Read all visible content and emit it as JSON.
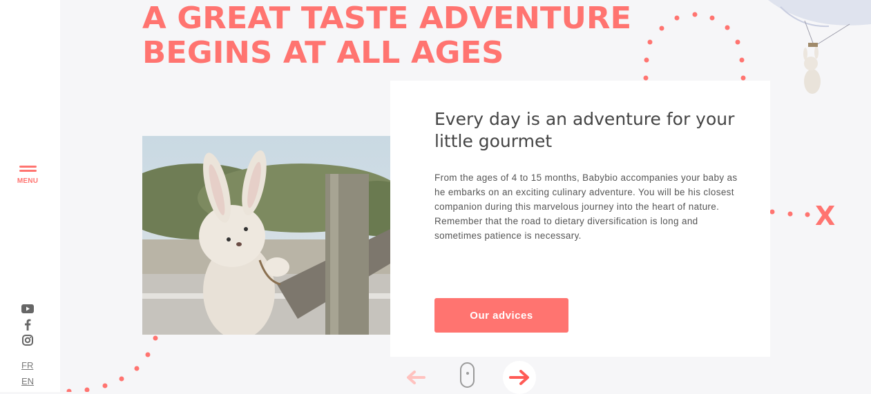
{
  "sidebar": {
    "menu_label": "MENU",
    "social": [
      {
        "name": "youtube-icon"
      },
      {
        "name": "facebook-icon"
      },
      {
        "name": "instagram-icon"
      }
    ],
    "languages": [
      "FR",
      "EN"
    ]
  },
  "hero": {
    "headline_line1": "A GREAT TASTE ADVENTURE",
    "headline_line2": "BEGINS AT ALL AGES"
  },
  "card": {
    "title": "Every day is an adventure for your little gourmet",
    "body": "From the ages of 4 to 15 months, Babybio accompanies your baby as he embarks on an exciting culinary adventure. You will be his closest companion during this marvelous journey into the heart of nature. Remember that the road to dietary diversification is long and sometimes patience is necessary.",
    "button_label": "Our advices"
  },
  "decor": {
    "trail_end_mark": "X"
  },
  "colors": {
    "accent": "#ff7470",
    "background": "#f6f6f8",
    "card": "#ffffff",
    "text": "#444444"
  }
}
